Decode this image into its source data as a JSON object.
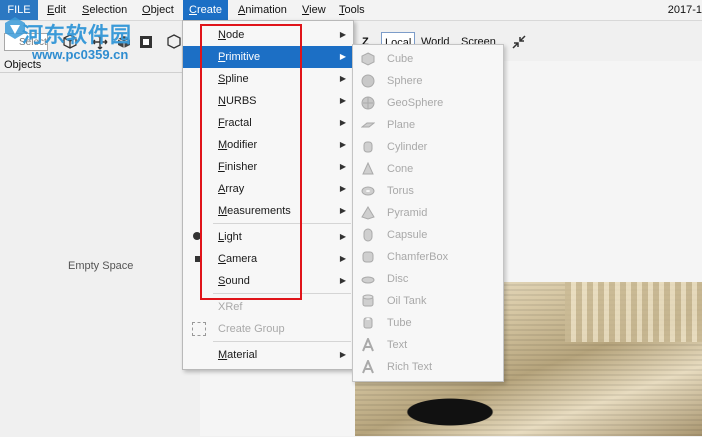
{
  "menubar": {
    "items": [
      "FILE",
      "Edit",
      "Selection",
      "Object",
      "Create",
      "Animation",
      "View",
      "Tools"
    ],
    "date": "2017-1"
  },
  "toolbar": {
    "select_label": "Select",
    "z_label": "Z",
    "coord_local": "Local",
    "coord_world": "World",
    "coord_screen": "Screen"
  },
  "objects_panel": {
    "label": "Objects",
    "empty_text": "Empty Space"
  },
  "watermark": {
    "title": "河东软件园",
    "url": "www.pc0359.cn"
  },
  "create_menu": {
    "items": [
      {
        "label": "Node",
        "mnemonic": "N",
        "rest": "ode",
        "submenu": true
      },
      {
        "label": "Primitive",
        "mnemonic": "P",
        "rest": "rimitive",
        "submenu": true
      },
      {
        "label": "Spline",
        "mnemonic": "S",
        "rest": "pline",
        "submenu": true
      },
      {
        "label": "NURBS",
        "mnemonic": "N",
        "rest": "URBS",
        "submenu": true
      },
      {
        "label": "Fractal",
        "mnemonic": "F",
        "rest": "ractal",
        "submenu": true
      },
      {
        "label": "Modifier",
        "mnemonic": "M",
        "rest": "odifier",
        "submenu": true
      },
      {
        "label": "Finisher",
        "mnemonic": "F",
        "rest": "inisher",
        "submenu": true
      },
      {
        "label": "Array",
        "mnemonic": "A",
        "rest": "rray",
        "submenu": true
      },
      {
        "label": "Measurements",
        "mnemonic": "M",
        "rest": "easurements",
        "submenu": true
      },
      {
        "label": "Light",
        "mnemonic": "L",
        "rest": "ight",
        "submenu": true
      },
      {
        "label": "Camera",
        "mnemonic": "C",
        "rest": "amera",
        "submenu": true
      },
      {
        "label": "Sound",
        "mnemonic": "S",
        "rest": "ound",
        "submenu": true
      },
      {
        "label": "XRef",
        "submenu": false,
        "disabled": true
      },
      {
        "label": "Create Group",
        "submenu": false,
        "disabled": true
      },
      {
        "label": "Material",
        "mnemonic": "M",
        "rest": "aterial",
        "submenu": true
      }
    ],
    "highlighted": "Primitive"
  },
  "primitive_menu": {
    "items": [
      "Cube",
      "Sphere",
      "GeoSphere",
      "Plane",
      "Cylinder",
      "Cone",
      "Torus",
      "Pyramid",
      "Capsule",
      "ChamferBox",
      "Disc",
      "Oil Tank",
      "Tube",
      "Text",
      "Rich Text"
    ],
    "disabled": true
  },
  "colors": {
    "accent": "#1c6fc5",
    "highlight_box": "#e0141a",
    "watermark": "#3a9ad8"
  }
}
